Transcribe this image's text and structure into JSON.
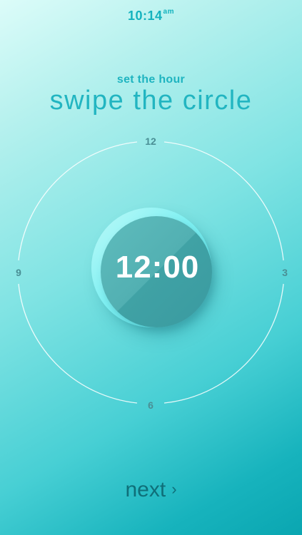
{
  "status": {
    "time": "10:14",
    "ampm": "am"
  },
  "header": {
    "subtitle": "set the hour",
    "title": "swipe the circle"
  },
  "dial": {
    "ticks": {
      "top": "12",
      "right": "3",
      "bottom": "6",
      "left": "9"
    },
    "selected_time": "12:00"
  },
  "footer": {
    "next_label": "next",
    "next_icon": "chevron-right-icon"
  },
  "colors": {
    "accent": "#22b5c1",
    "knob_face": "#4aa9ac",
    "next_text": "#0f6f79"
  }
}
